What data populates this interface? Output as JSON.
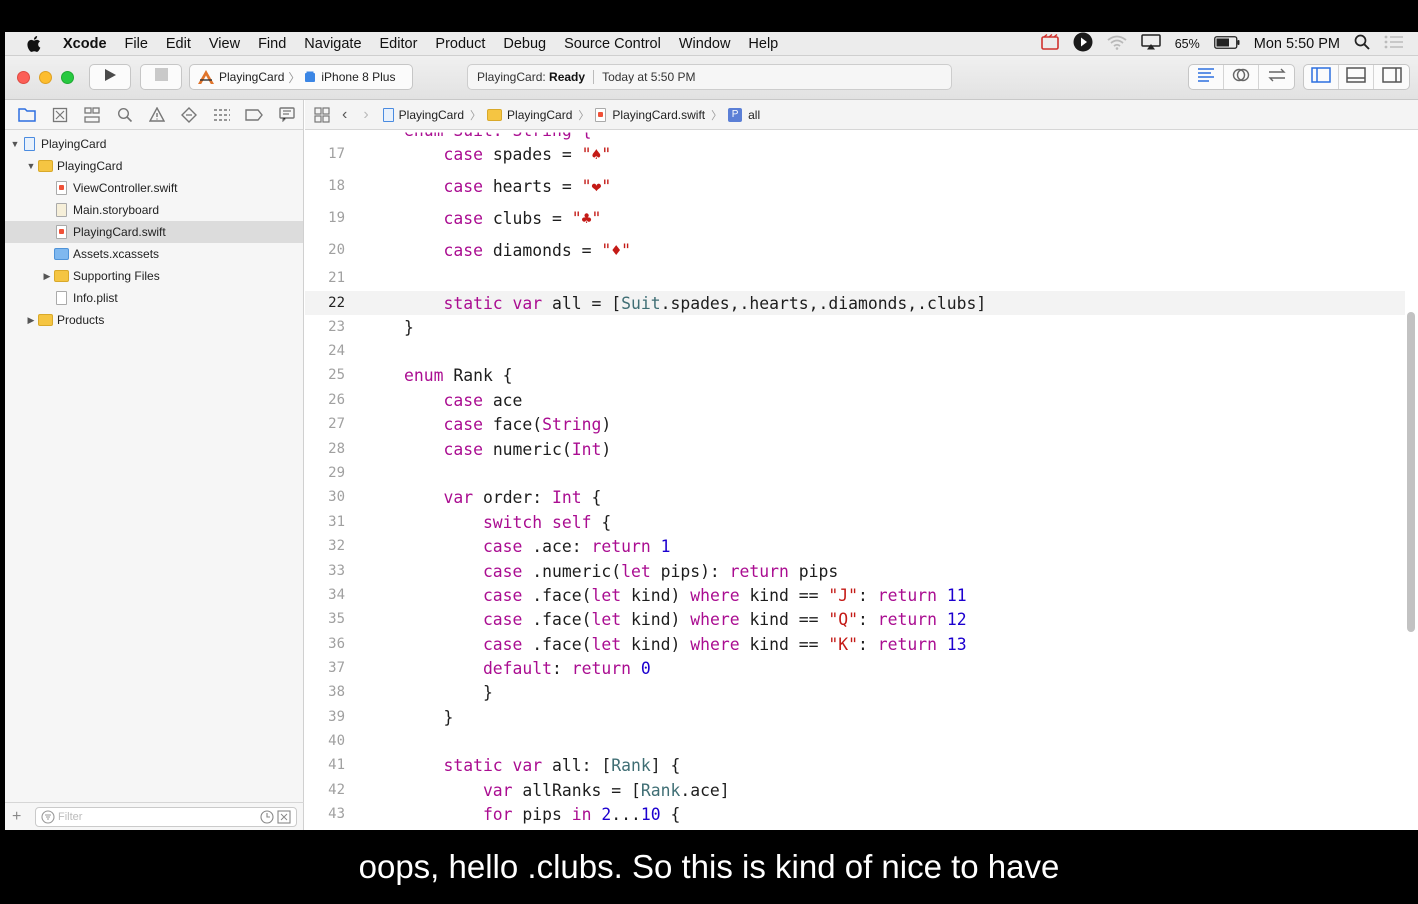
{
  "menubar": {
    "app_name": "Xcode",
    "items": [
      "File",
      "Edit",
      "View",
      "Find",
      "Navigate",
      "Editor",
      "Product",
      "Debug",
      "Source Control",
      "Window",
      "Help"
    ],
    "battery": "65%",
    "clock": "Mon 5:50 PM"
  },
  "toolbar": {
    "scheme": "PlayingCard",
    "device": "iPhone 8 Plus",
    "status_project": "PlayingCard:",
    "status_state": "Ready",
    "status_time": "Today at 5:50 PM"
  },
  "navigator": {
    "tree": [
      {
        "label": "PlayingCard",
        "indent": 0,
        "kind": "project",
        "disclosure": "open"
      },
      {
        "label": "PlayingCard",
        "indent": 1,
        "kind": "folder",
        "disclosure": "open"
      },
      {
        "label": "ViewController.swift",
        "indent": 2,
        "kind": "swift"
      },
      {
        "label": "Main.storyboard",
        "indent": 2,
        "kind": "file"
      },
      {
        "label": "PlayingCard.swift",
        "indent": 2,
        "kind": "swift",
        "selected": true
      },
      {
        "label": "Assets.xcassets",
        "indent": 2,
        "kind": "assets"
      },
      {
        "label": "Supporting Files",
        "indent": 2,
        "kind": "folder",
        "disclosure": "closed"
      },
      {
        "label": "Info.plist",
        "indent": 2,
        "kind": "file"
      },
      {
        "label": "Products",
        "indent": 1,
        "kind": "folder",
        "disclosure": "closed"
      }
    ],
    "filter_placeholder": "Filter"
  },
  "jumpbar": {
    "crumbs": [
      "PlayingCard",
      "PlayingCard",
      "PlayingCard.swift",
      "all"
    ]
  },
  "editor": {
    "current_line": "22",
    "lines": [
      {
        "n": "17",
        "tokens": [
          [
            "    case ",
            "kw"
          ],
          [
            "spades = ",
            ""
          ],
          [
            "\"♠\"",
            "str"
          ]
        ]
      },
      {
        "n": "18",
        "tokens": [
          [
            "    case ",
            "kw"
          ],
          [
            "hearts = ",
            ""
          ],
          [
            "\"❤\"",
            "str"
          ]
        ]
      },
      {
        "n": "19",
        "tokens": [
          [
            "    case ",
            "kw"
          ],
          [
            "clubs = ",
            ""
          ],
          [
            "\"♣\"",
            "str"
          ]
        ]
      },
      {
        "n": "20",
        "tokens": [
          [
            "    case ",
            "kw"
          ],
          [
            "diamonds = ",
            ""
          ],
          [
            "\"♦\"",
            "str"
          ]
        ]
      },
      {
        "n": "21",
        "tokens": []
      },
      {
        "n": "22",
        "tokens": [
          [
            "    static var ",
            "kw"
          ],
          [
            "all = [",
            ""
          ],
          [
            "Suit",
            "ty"
          ],
          [
            ".spades,.hearts,.diamonds,.clubs]",
            ""
          ]
        ]
      },
      {
        "n": "23",
        "tokens": [
          [
            "}",
            ""
          ]
        ]
      },
      {
        "n": "24",
        "tokens": []
      },
      {
        "n": "25",
        "tokens": [
          [
            "enum ",
            "kw"
          ],
          [
            "Rank {",
            ""
          ]
        ]
      },
      {
        "n": "26",
        "tokens": [
          [
            "    case ",
            "kw"
          ],
          [
            "ace",
            ""
          ]
        ]
      },
      {
        "n": "27",
        "tokens": [
          [
            "    case ",
            "kw"
          ],
          [
            "face(",
            ""
          ],
          [
            "String",
            "kw"
          ],
          [
            ")",
            ""
          ]
        ]
      },
      {
        "n": "28",
        "tokens": [
          [
            "    case ",
            "kw"
          ],
          [
            "numeric(",
            ""
          ],
          [
            "Int",
            "kw"
          ],
          [
            ")",
            ""
          ]
        ]
      },
      {
        "n": "29",
        "tokens": []
      },
      {
        "n": "30",
        "tokens": [
          [
            "    var ",
            "kw"
          ],
          [
            "order: ",
            ""
          ],
          [
            "Int",
            "kw"
          ],
          [
            " {",
            ""
          ]
        ]
      },
      {
        "n": "31",
        "tokens": [
          [
            "        switch self",
            "kw"
          ],
          [
            " {",
            ""
          ]
        ]
      },
      {
        "n": "32",
        "tokens": [
          [
            "        case ",
            "kw"
          ],
          [
            ".ace: ",
            ""
          ],
          [
            "return ",
            "kw"
          ],
          [
            "1",
            "num"
          ]
        ]
      },
      {
        "n": "33",
        "tokens": [
          [
            "        case ",
            "kw"
          ],
          [
            ".numeric(",
            ""
          ],
          [
            "let ",
            "kw"
          ],
          [
            "pips): ",
            ""
          ],
          [
            "return ",
            "kw"
          ],
          [
            "pips",
            ""
          ]
        ]
      },
      {
        "n": "34",
        "tokens": [
          [
            "        case ",
            "kw"
          ],
          [
            ".face(",
            ""
          ],
          [
            "let ",
            "kw"
          ],
          [
            "kind) ",
            ""
          ],
          [
            "where ",
            "kw"
          ],
          [
            "kind == ",
            ""
          ],
          [
            "\"J\"",
            "str"
          ],
          [
            ": ",
            ""
          ],
          [
            "return ",
            "kw"
          ],
          [
            "11",
            "num"
          ]
        ]
      },
      {
        "n": "35",
        "tokens": [
          [
            "        case ",
            "kw"
          ],
          [
            ".face(",
            ""
          ],
          [
            "let ",
            "kw"
          ],
          [
            "kind) ",
            ""
          ],
          [
            "where ",
            "kw"
          ],
          [
            "kind == ",
            ""
          ],
          [
            "\"Q\"",
            "str"
          ],
          [
            ": ",
            ""
          ],
          [
            "return ",
            "kw"
          ],
          [
            "12",
            "num"
          ]
        ]
      },
      {
        "n": "36",
        "tokens": [
          [
            "        case ",
            "kw"
          ],
          [
            ".face(",
            ""
          ],
          [
            "let ",
            "kw"
          ],
          [
            "kind) ",
            ""
          ],
          [
            "where ",
            "kw"
          ],
          [
            "kind == ",
            ""
          ],
          [
            "\"K\"",
            "str"
          ],
          [
            ": ",
            ""
          ],
          [
            "return ",
            "kw"
          ],
          [
            "13",
            "num"
          ]
        ]
      },
      {
        "n": "37",
        "tokens": [
          [
            "        default",
            "kw"
          ],
          [
            ": ",
            ""
          ],
          [
            "return ",
            "kw"
          ],
          [
            "0",
            "num"
          ]
        ]
      },
      {
        "n": "38",
        "tokens": [
          [
            "        }",
            ""
          ]
        ]
      },
      {
        "n": "39",
        "tokens": [
          [
            "    }",
            ""
          ]
        ]
      },
      {
        "n": "40",
        "tokens": []
      },
      {
        "n": "41",
        "tokens": [
          [
            "    static var ",
            "kw"
          ],
          [
            "all: [",
            ""
          ],
          [
            "Rank",
            "ty"
          ],
          [
            "] {",
            ""
          ]
        ]
      },
      {
        "n": "42",
        "tokens": [
          [
            "        var ",
            "kw"
          ],
          [
            "allRanks = [",
            ""
          ],
          [
            "Rank",
            "ty"
          ],
          [
            ".ace]",
            ""
          ]
        ]
      },
      {
        "n": "43",
        "tokens": [
          [
            "        for ",
            "kw"
          ],
          [
            "pips ",
            ""
          ],
          [
            "in ",
            "kw"
          ],
          [
            "2",
            "num"
          ],
          [
            "...",
            ""
          ],
          [
            "10",
            "num"
          ],
          [
            " {",
            ""
          ]
        ]
      }
    ]
  },
  "subtitle": "oops, hello .clubs. So this is kind of nice to have"
}
